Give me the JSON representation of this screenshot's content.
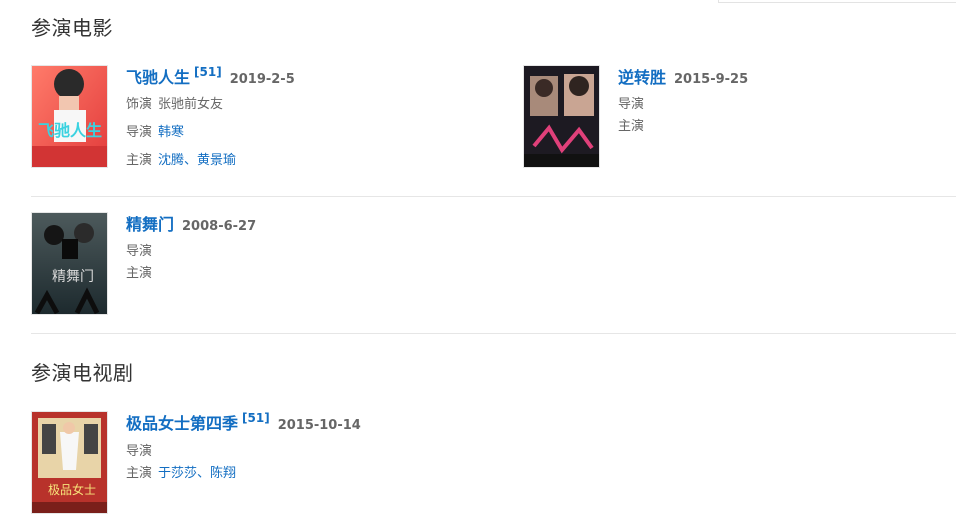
{
  "movies_section": {
    "title": "参演电影",
    "items": [
      {
        "title": "飞驰人生",
        "ref": "[51]",
        "date": "2019-2-5",
        "role_label": "饰演",
        "role": "张驰前女友",
        "director_label": "导演",
        "director": "韩寒",
        "cast_label": "主演",
        "cast": [
          "沈腾",
          "黄景瑜"
        ],
        "cast_sep": "、",
        "poster_icon": "movie-poster"
      },
      {
        "title": "逆转胜",
        "date": "2015-9-25",
        "director_label": "导演",
        "cast_label": "主演",
        "poster_icon": "movie-poster"
      },
      {
        "title": "精舞门",
        "date": "2008-6-27",
        "director_label": "导演",
        "cast_label": "主演",
        "poster_icon": "movie-poster"
      }
    ]
  },
  "tv_section": {
    "title": "参演电视剧",
    "items": [
      {
        "title": "极品女士第四季",
        "ref": "[51]",
        "date": "2015-10-14",
        "director_label": "导演",
        "cast_label": "主演",
        "cast": [
          "于莎莎",
          "陈翔"
        ],
        "cast_sep": "、",
        "poster_icon": "tv-poster"
      }
    ]
  },
  "colors": {
    "link": "#136ec2",
    "text": "#333333",
    "muted": "#666666",
    "divider": "#e6e6e6"
  }
}
